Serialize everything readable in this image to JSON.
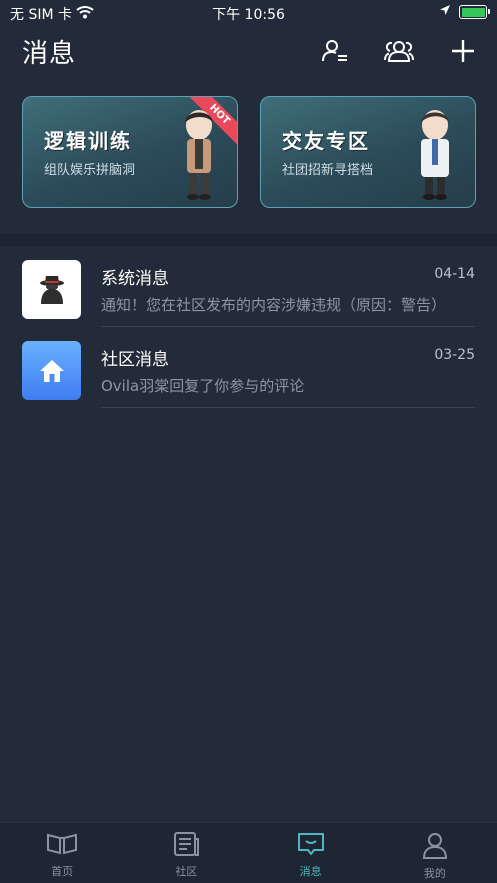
{
  "status_bar": {
    "carrier": "无 SIM 卡",
    "time": "下午 10:56"
  },
  "header": {
    "title": "消息",
    "icons": [
      "contacts-icon",
      "group-icon",
      "add-icon"
    ]
  },
  "cards": [
    {
      "title": "逻辑训练",
      "subtitle": "组队娱乐拼脑洞",
      "badge": "HOT"
    },
    {
      "title": "交友专区",
      "subtitle": "社团招新寻搭档"
    }
  ],
  "messages": [
    {
      "name": "系统消息",
      "date": "04-14",
      "preview": "通知！您在社区发布的内容涉嫌违规（原因：警告）",
      "avatar": "detective-icon"
    },
    {
      "name": "社区消息",
      "date": "03-25",
      "preview": "Ovila羽棠回复了你参与的评论",
      "avatar": "home-icon"
    }
  ],
  "tabs": [
    {
      "label": "首页",
      "icon": "book-open-icon"
    },
    {
      "label": "社区",
      "icon": "newspaper-icon"
    },
    {
      "label": "消息",
      "icon": "chat-icon",
      "active": true
    },
    {
      "label": "我的",
      "icon": "user-icon"
    }
  ],
  "colors": {
    "background": "#232b3a",
    "card_border": "#5aa4b3",
    "accent": "#4fb6c2",
    "hot": "#e8495b",
    "battery": "#34c759"
  }
}
